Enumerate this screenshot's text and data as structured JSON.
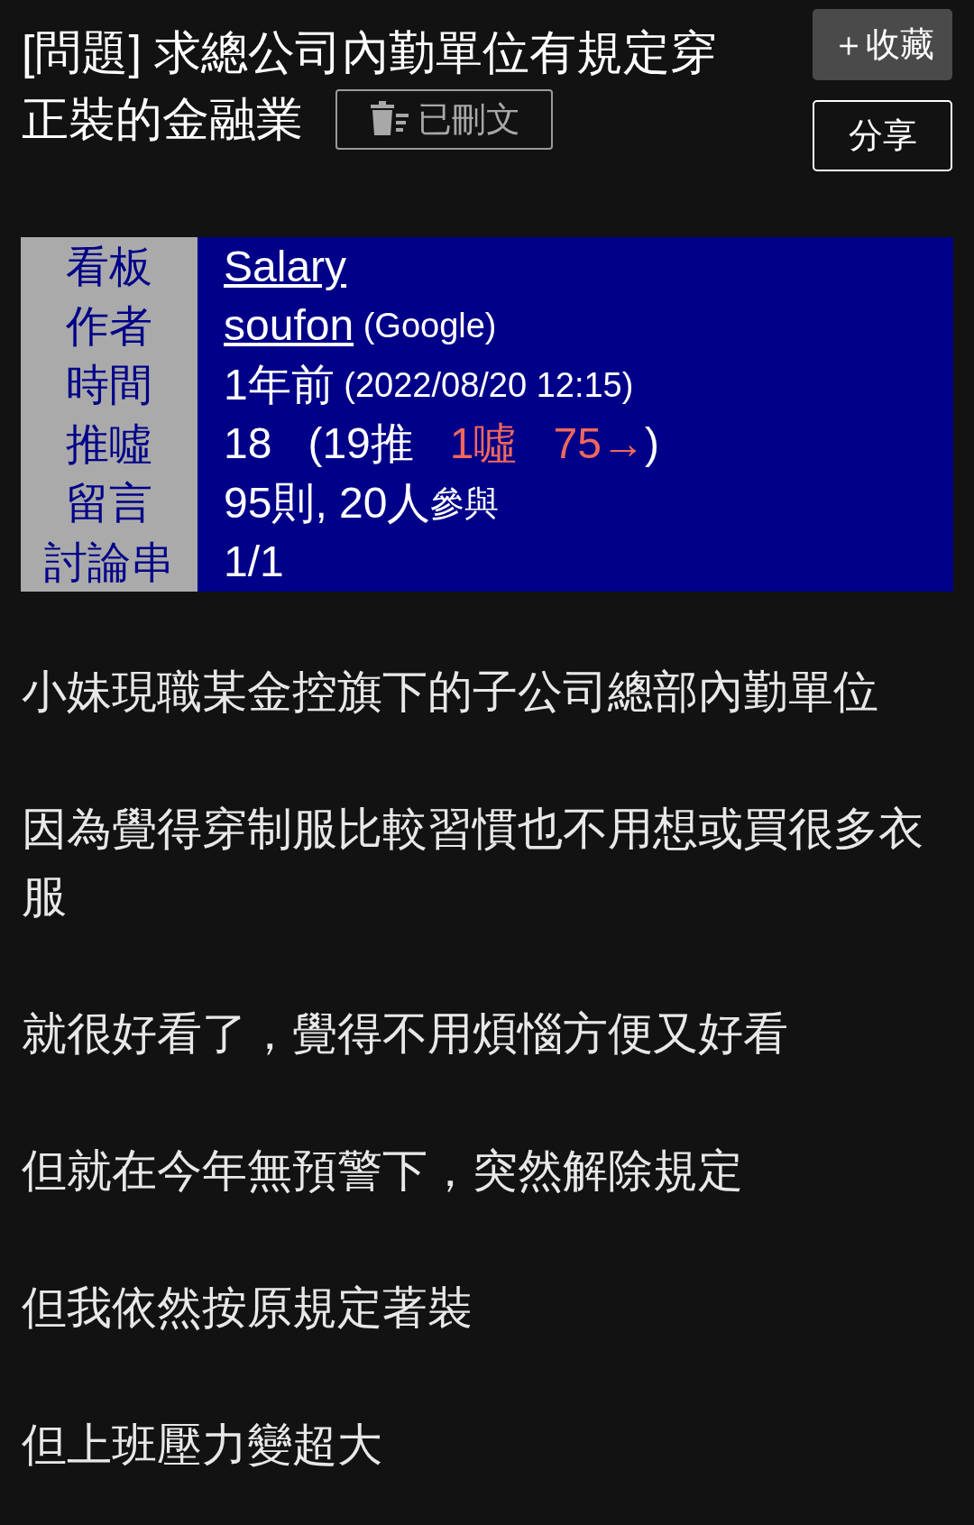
{
  "title_lines": [
    "[問題] 求總公司內勤單位有規定穿",
    "正裝的金融業"
  ],
  "deleted_badge": "已刪文",
  "buttons": {
    "favorite": "＋收藏",
    "share": "分享"
  },
  "meta": [
    {
      "label": "看板",
      "parts": [
        {
          "text": "Salary",
          "kind": "link"
        }
      ]
    },
    {
      "label": "作者",
      "parts": [
        {
          "text": "soufon",
          "kind": "link"
        },
        {
          "text": " (Google)",
          "kind": "small"
        }
      ]
    },
    {
      "label": "時間",
      "parts": [
        {
          "text": "1年前",
          "kind": "plain"
        },
        {
          "text": " (2022/08/20 12:15)",
          "kind": "small"
        }
      ]
    },
    {
      "label": "推噓",
      "parts": [
        {
          "text": "18",
          "kind": "plain"
        },
        {
          "text": "   (19推",
          "kind": "plain"
        },
        {
          "text": "   1噓",
          "kind": "boo"
        },
        {
          "text": "   75→",
          "kind": "boo"
        },
        {
          "text": ")",
          "kind": "plain"
        }
      ]
    },
    {
      "label": "留言",
      "parts": [
        {
          "text": "95則, 20人",
          "kind": "plain"
        },
        {
          "text": "參與",
          "kind": "small"
        }
      ]
    },
    {
      "label": "討論串",
      "parts": [
        {
          "text": "1/1",
          "kind": "plain"
        }
      ]
    }
  ],
  "body": [
    "小妹現職某金控旗下的子公司總部內勤單位",
    "因為覺得穿制服比較習慣也不用想或買很多衣服",
    "就很好看了，覺得不用煩惱方便又好看",
    "但就在今年無預警下，突然解除規定",
    "但我依然按原規定著裝",
    "但上班壓力變超大"
  ]
}
